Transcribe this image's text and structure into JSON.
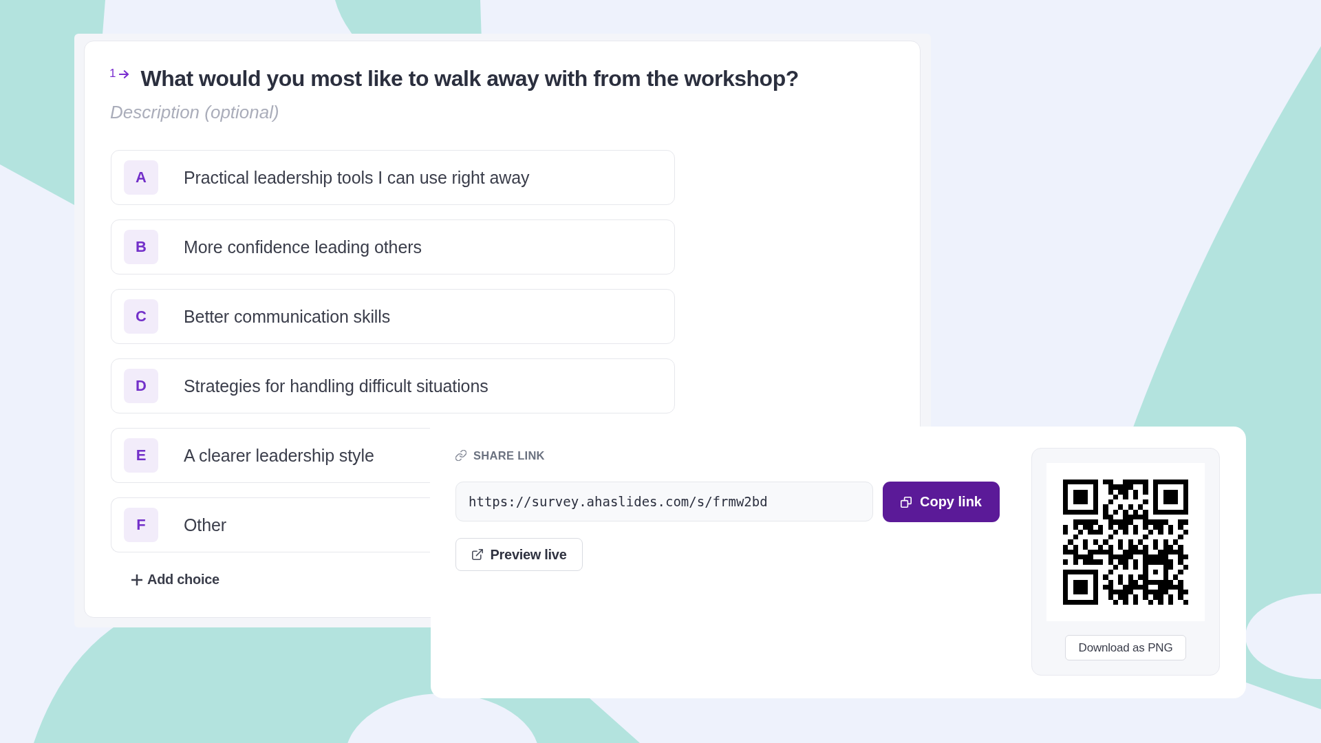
{
  "question": {
    "number": "1",
    "title": "What would you most like to walk away with from the workshop?",
    "description": {
      "placeholder": "Description (optional)"
    },
    "choices": [
      {
        "letter": "A",
        "text": "Practical leadership tools I can use right away"
      },
      {
        "letter": "B",
        "text": "More confidence leading others"
      },
      {
        "letter": "C",
        "text": "Better communication skills"
      },
      {
        "letter": "D",
        "text": "Strategies for handling difficult situations"
      },
      {
        "letter": "E",
        "text": "A clearer leadership style"
      },
      {
        "letter": "F",
        "text": "Other"
      }
    ],
    "add_choice": "Add choice"
  },
  "share": {
    "label": "SHARE LINK",
    "url": "https://survey.ahaslides.com/s/frmw2bd",
    "copy_button": "Copy link",
    "preview_button": "Preview live",
    "qr": {
      "download_button": "Download as PNG"
    }
  }
}
